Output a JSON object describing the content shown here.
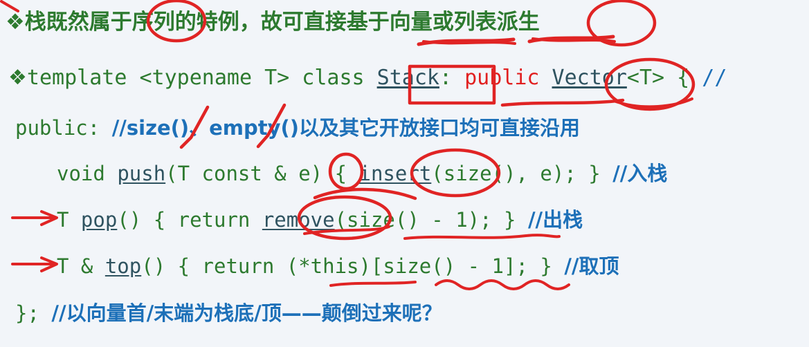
{
  "slide": {
    "background_color": "#f2f5f9",
    "palette": {
      "code_green": "#2d7a2f",
      "comment_blue": "#1d70b8",
      "keyword_red": "#e12020",
      "identifier_blue": "#2f5360",
      "ink_red": "#e02424"
    },
    "bullet_glyph": "❖"
  },
  "lines": {
    "line1": {
      "bullet": "❖",
      "text": "栈既然属于序列的特例，故可直接基于向量或列表派生"
    },
    "line2": {
      "bullet": "❖",
      "seg1": "template <typename T> class ",
      "ident_stack": "Stack",
      "seg2": ": ",
      "kw_public": "public ",
      "ident_vector": "Vector",
      "seg3": "<T> { ",
      "comment": "//"
    },
    "line3": {
      "code": "public: ",
      "comment": "//size()、empty()以及其它开放接口均可直接沿用"
    },
    "line4": {
      "seg1": "void ",
      "ident_push": "push",
      "seg2": "(T const & e) { ",
      "ident_insert": "insert",
      "seg3": "(size(), e); } ",
      "comment": "//入栈"
    },
    "line5": {
      "seg1": "T ",
      "ident_pop": "pop",
      "seg2": "() { return ",
      "ident_remove": "remove",
      "seg3": "(size() - 1); } ",
      "comment": "//出栈"
    },
    "line6": {
      "seg1": "T & ",
      "ident_top": "top",
      "seg2": "() { return (*this)[size() - 1]; } ",
      "comment": "//取顶"
    },
    "line7": {
      "code": "}; ",
      "comment": "//以向量首/末端为栈底/顶——颠倒过来呢？"
    }
  },
  "annotations": {
    "circle_xulie": "序列",
    "underline_xiangliang": "向量",
    "underline_liebiao": "列表",
    "circle_paisheng": "派生",
    "box_stack": "Stack",
    "underline_public": "public",
    "circle_vector": "Vector",
    "check_size": "size()",
    "check_empty": "empty()",
    "circle_e": "e",
    "circle_insert": "insert",
    "arrow_pop_line": "T pop()",
    "circle_remove": "remove",
    "wavy_underline_pop_arg": "size() - 1",
    "arrow_top_line": "T & top()",
    "underline_this": "(*this)",
    "wavy_underline_top_arg": "[size() - 1]"
  }
}
